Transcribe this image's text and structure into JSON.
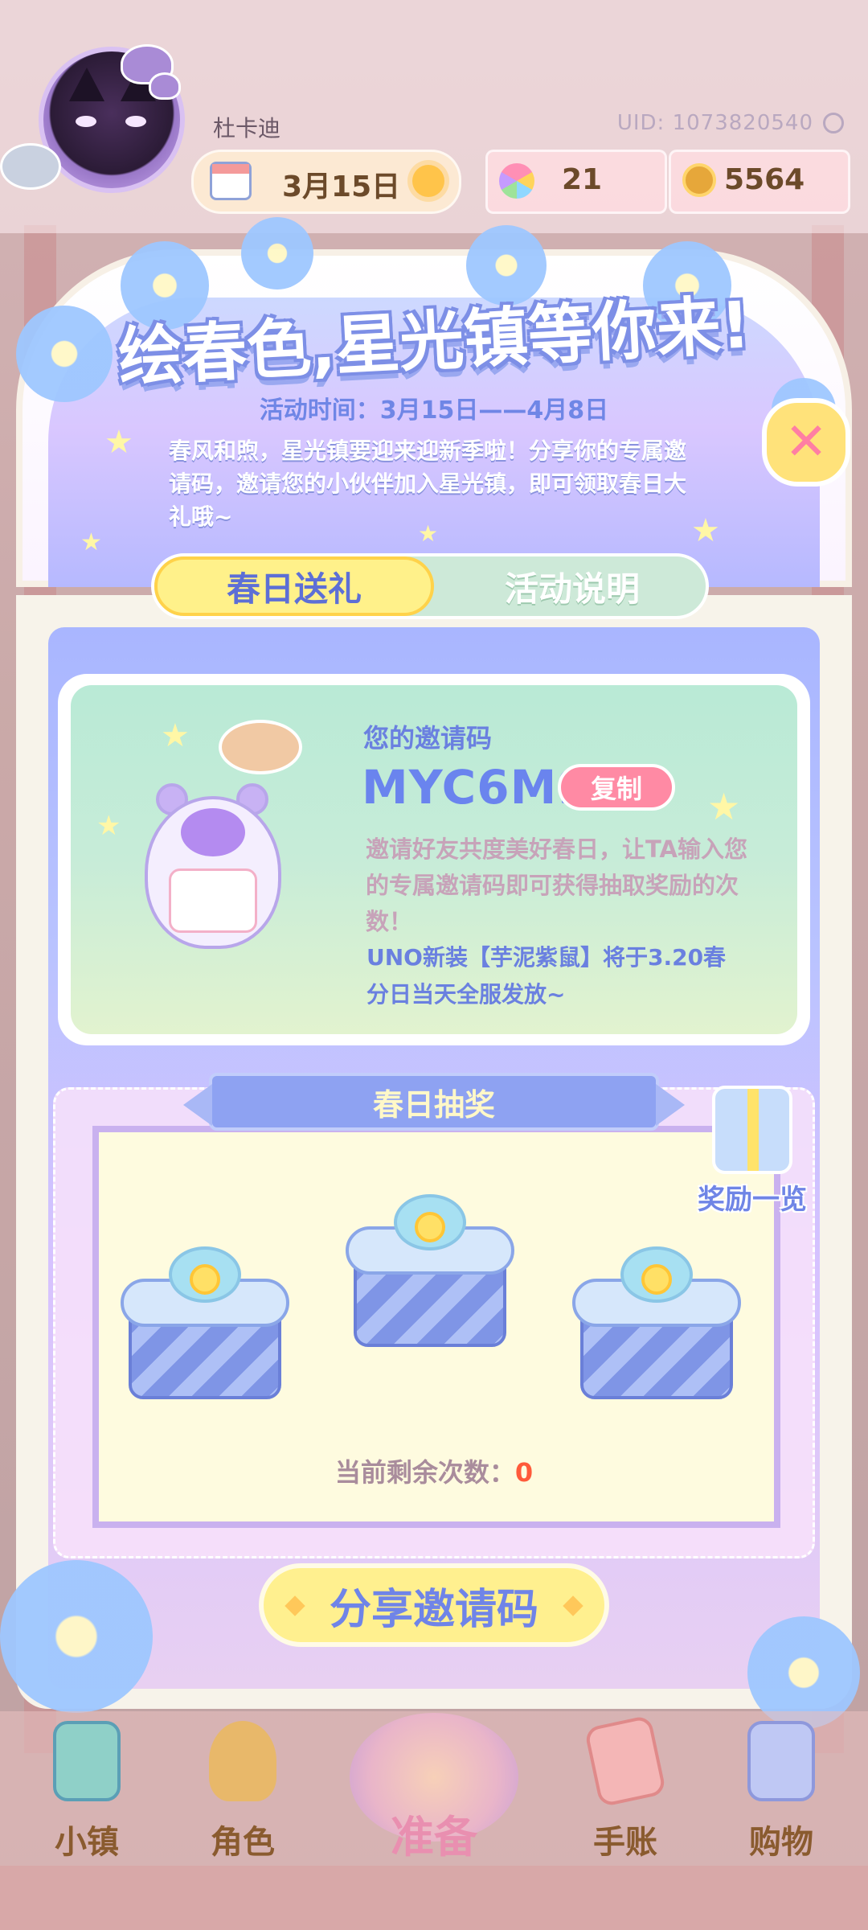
{
  "header": {
    "username": "杜卡迪",
    "uid": "UID: 1073820540",
    "date": "3月15日",
    "gems": "21",
    "coins": "5564"
  },
  "event": {
    "title": "绘春色,星光镇等你来!",
    "period": "活动时间：3月15日——4月8日",
    "intro": "春风和煦，星光镇要迎来迎新季啦！分享你的专属邀请码，邀请您的小伙伴加入星光镇，即可领取春日大礼哦~",
    "close_icon": "close-icon",
    "tabs": [
      {
        "label": "春日送礼",
        "active": true
      },
      {
        "label": "活动说明",
        "active": false
      }
    ]
  },
  "invite": {
    "label": "您的邀请码",
    "code": "MYC6M9",
    "copy_label": "复制",
    "description": "邀请好友共度美好春日，让TA输入您的专属邀请码即可获得抽取奖励的次数！",
    "news": "UNO新装【芋泥紫鼠】将于3.20春分日当天全服发放~"
  },
  "lottery": {
    "title": "春日抽奖",
    "reward_label": "奖励一览",
    "remaining_label": "当前剩余次数：",
    "remaining_count": "0",
    "gift_count": 3
  },
  "share_button": "分享邀请码",
  "nav": [
    {
      "label": "小镇",
      "icon": "map-icon"
    },
    {
      "label": "角色",
      "icon": "character-icon"
    },
    {
      "label": "准备",
      "icon": "prepare-icon"
    },
    {
      "label": "手账",
      "icon": "journal-icon"
    },
    {
      "label": "购物",
      "icon": "shopping-bag-icon"
    }
  ],
  "colors": {
    "accent_blue": "#6a80e0",
    "tab_active": "#fff18a",
    "copy_button": "#ff8aa4",
    "remaining_count": "#ff5a3a"
  }
}
